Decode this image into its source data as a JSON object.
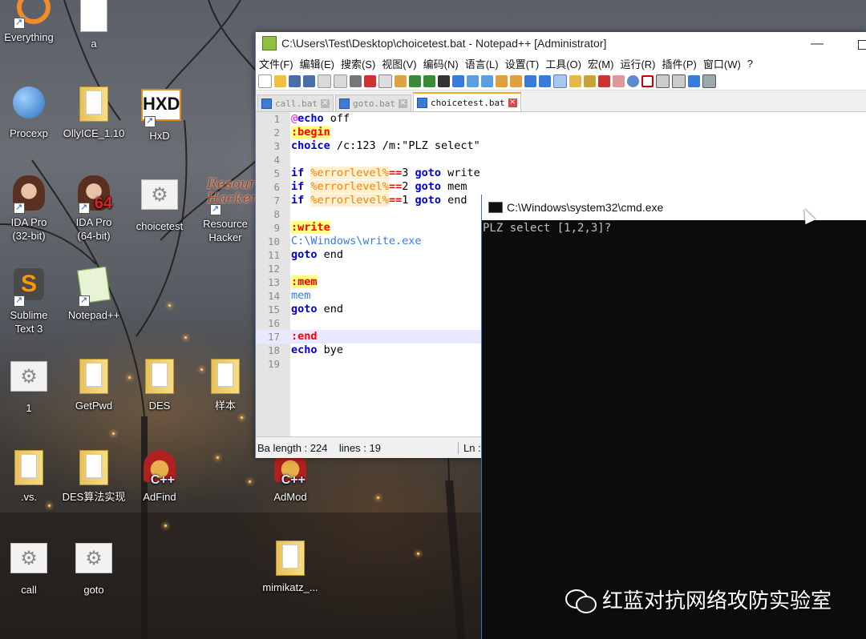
{
  "desktop_icons": [
    {
      "label": "Everything",
      "type": "app",
      "color": "#f28c28"
    },
    {
      "label": "a",
      "type": "doc"
    },
    {
      "label": "Procexp",
      "type": "app",
      "color": "#3a7fd0"
    },
    {
      "label": "OllyICE_1.10",
      "type": "folder"
    },
    {
      "label": "HxD",
      "type": "app",
      "color": "#e08a1e"
    },
    {
      "label": "IDA Pro\n(32-bit)",
      "type": "app",
      "color": "#b07050"
    },
    {
      "label": "IDA Pro\n(64-bit)",
      "type": "app",
      "color": "#b07050"
    },
    {
      "label": "choicetest",
      "type": "gear"
    },
    {
      "label": "Resource\nHacker",
      "type": "app",
      "color": "#8b3a1a"
    },
    {
      "label": "Sublime\nText 3",
      "type": "app",
      "color": "#ff9800"
    },
    {
      "label": "Notepad++",
      "type": "app",
      "color": "#7ab648"
    },
    {
      "label": "1",
      "type": "gear"
    },
    {
      "label": "GetPwd",
      "type": "folder"
    },
    {
      "label": "DES",
      "type": "folder"
    },
    {
      "label": "样本",
      "type": "folder"
    },
    {
      "label": ".vs.",
      "type": "app",
      "color": "#333333"
    },
    {
      "label": "DES算法实现",
      "type": "folder"
    },
    {
      "label": "AdFind",
      "type": "app",
      "color": "#c0392b"
    },
    {
      "label": "AdMod",
      "type": "app",
      "color": "#c0392b"
    },
    {
      "label": "call",
      "type": "gear"
    },
    {
      "label": "goto",
      "type": "gear"
    },
    {
      "label": "mimikatz_...",
      "type": "folder"
    }
  ],
  "notepad": {
    "title": "C:\\Users\\Test\\Desktop\\choicetest.bat - Notepad++ [Administrator]",
    "menu": [
      "文件(F)",
      "编辑(E)",
      "搜索(S)",
      "视图(V)",
      "编码(N)",
      "语言(L)",
      "设置(T)",
      "工具(O)",
      "宏(M)",
      "运行(R)",
      "插件(P)",
      "窗口(W)",
      "?"
    ],
    "tabs": [
      {
        "label": "call.bat",
        "active": false
      },
      {
        "label": "goto.bat",
        "active": false
      },
      {
        "label": "choicetest.bat",
        "active": true
      }
    ],
    "current_line": 17,
    "status": {
      "length": "Ba length : 224    lines : 19",
      "pos": "Ln :"
    }
  },
  "cmd": {
    "title": "C:\\Windows\\system32\\cmd.exe",
    "output": "PLZ select [1,2,3]?"
  },
  "watermark": "红蓝对抗网络攻防实验室"
}
